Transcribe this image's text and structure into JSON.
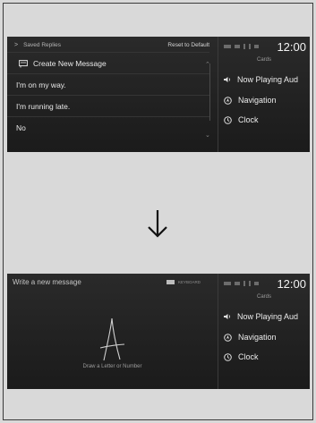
{
  "screen_before": {
    "header": {
      "title": "Saved Replies",
      "reset_label": "Reset to Default"
    },
    "rows": [
      {
        "label": "Create New Message",
        "icon": "message-icon"
      },
      {
        "label": "I'm on my way."
      },
      {
        "label": "I'm running late."
      },
      {
        "label": "No"
      }
    ]
  },
  "screen_after": {
    "title": "Write a new message",
    "keyboard_label": "KEYBOARD",
    "drawn_letter": "A",
    "hint": "Draw a Letter or Number"
  },
  "status": {
    "clock": "12:00"
  },
  "cards": {
    "label": "Cards",
    "items": [
      {
        "label": "Now Playing Aud",
        "icon": "speaker-icon"
      },
      {
        "label": "Navigation",
        "icon": "navigation-icon"
      },
      {
        "label": "Clock",
        "icon": "clock-icon"
      }
    ]
  }
}
